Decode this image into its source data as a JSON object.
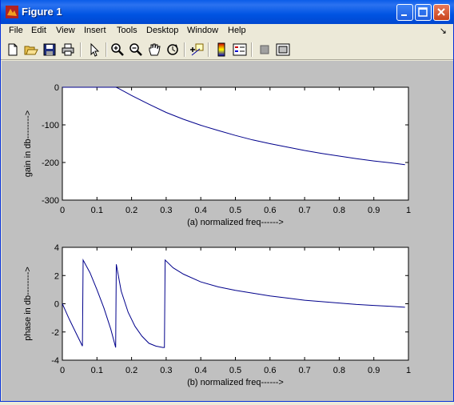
{
  "window": {
    "title": "Figure 1"
  },
  "menu": [
    "File",
    "Edit",
    "View",
    "Insert",
    "Tools",
    "Desktop",
    "Window",
    "Help"
  ],
  "menu_arrow": "↘",
  "toolbar": {
    "icons": [
      "new-figure-icon",
      "open-file-icon",
      "save-icon",
      "print-icon",
      "edit-plot-icon",
      "zoom-in-icon",
      "zoom-out-icon",
      "pan-icon",
      "rotate-3d-icon",
      "data-cursor-icon",
      "colorbar-icon",
      "legend-icon",
      "hide-plot-tools-icon",
      "show-plot-tools-icon"
    ]
  },
  "colors": {
    "line": "#00008b",
    "figure_bg": "#c0c0c0",
    "axes_bg": "#ffffff"
  },
  "chart_data": [
    {
      "type": "line",
      "xlabel": "(a) normalized freq------>",
      "ylabel": "gain in db-------->",
      "xlim": [
        0,
        1
      ],
      "ylim": [
        -300,
        0
      ],
      "xticks": [
        "0",
        "0.1",
        "0.2",
        "0.3",
        "0.4",
        "0.5",
        "0.6",
        "0.7",
        "0.8",
        "0.9",
        "1"
      ],
      "yticks": [
        "0",
        "-100",
        "-200",
        "-300"
      ],
      "x": [
        0,
        0.05,
        0.1,
        0.155,
        0.16,
        0.18,
        0.2,
        0.25,
        0.3,
        0.35,
        0.4,
        0.45,
        0.5,
        0.55,
        0.6,
        0.65,
        0.7,
        0.75,
        0.8,
        0.85,
        0.9,
        0.95,
        0.99
      ],
      "y": [
        0,
        0,
        0,
        0,
        -2,
        -12,
        -22,
        -45,
        -67,
        -85,
        -101,
        -115,
        -128,
        -140,
        -150,
        -159,
        -168,
        -176,
        -183,
        -190,
        -196,
        -201,
        -206
      ]
    },
    {
      "type": "line",
      "xlabel": "(b) normalized freq------>",
      "ylabel": "phase in db-------->",
      "xlim": [
        0,
        1
      ],
      "ylim": [
        -4,
        4
      ],
      "xticks": [
        "0",
        "0.1",
        "0.2",
        "0.3",
        "0.4",
        "0.5",
        "0.6",
        "0.7",
        "0.8",
        "0.9",
        "1"
      ],
      "yticks": [
        "4",
        "2",
        "0",
        "-2",
        "-4"
      ],
      "x": [
        0,
        0.02,
        0.04,
        0.058,
        0.06,
        0.08,
        0.1,
        0.12,
        0.14,
        0.154,
        0.156,
        0.17,
        0.19,
        0.21,
        0.23,
        0.25,
        0.27,
        0.29,
        0.295,
        0.297,
        0.32,
        0.35,
        0.4,
        0.45,
        0.5,
        0.55,
        0.6,
        0.65,
        0.7,
        0.75,
        0.8,
        0.85,
        0.9,
        0.95,
        0.99
      ],
      "y": [
        0,
        -1.1,
        -2.1,
        -3.0,
        3.1,
        2.2,
        1.0,
        -0.3,
        -1.8,
        -3.1,
        2.8,
        0.9,
        -0.6,
        -1.6,
        -2.3,
        -2.8,
        -3.0,
        -3.1,
        -3.1,
        3.1,
        2.55,
        2.1,
        1.55,
        1.2,
        0.95,
        0.75,
        0.55,
        0.4,
        0.25,
        0.15,
        0.05,
        -0.05,
        -0.12,
        -0.18,
        -0.25
      ]
    }
  ]
}
